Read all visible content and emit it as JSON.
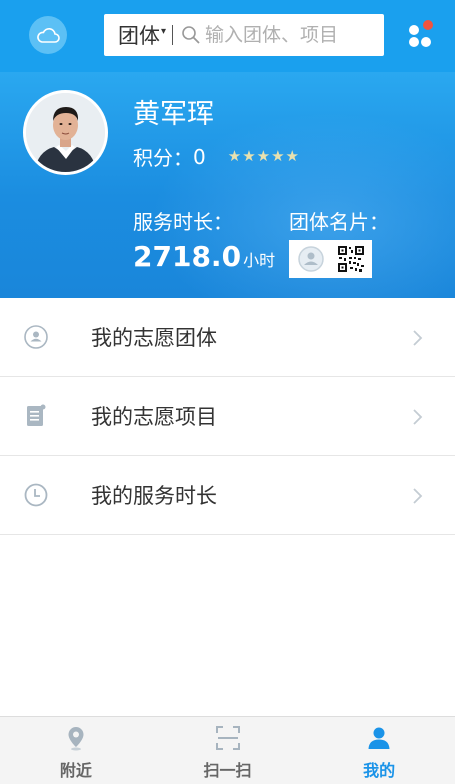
{
  "topbar": {
    "search_type": "团体",
    "search_placeholder": "输入团体、项目",
    "icons": [
      "cloud-icon",
      "search-icon",
      "apps-grid-icon"
    ],
    "notification_dot_color": "#f0533f"
  },
  "profile": {
    "name": "黄军珲",
    "points_label": "积分：",
    "points_value": "0",
    "star_rating": 5,
    "service_label": "服务时长：",
    "service_value": "2718.0",
    "service_unit": "小时",
    "card_label": "团体名片："
  },
  "menu": {
    "items": [
      {
        "label": "我的志愿团体",
        "icon": "group-icon"
      },
      {
        "label": "我的志愿项目",
        "icon": "document-icon"
      },
      {
        "label": "我的服务时长",
        "icon": "clock-icon"
      }
    ]
  },
  "bottom_nav": {
    "items": [
      {
        "label": "附近",
        "icon": "location-pin-icon",
        "active": false
      },
      {
        "label": "扫一扫",
        "icon": "scan-icon",
        "active": false
      },
      {
        "label": "我的",
        "icon": "person-icon",
        "active": true
      }
    ]
  },
  "colors": {
    "primary": "#1aa0ee",
    "active_nav": "#1a93e8",
    "star": "#e7e1b0"
  }
}
